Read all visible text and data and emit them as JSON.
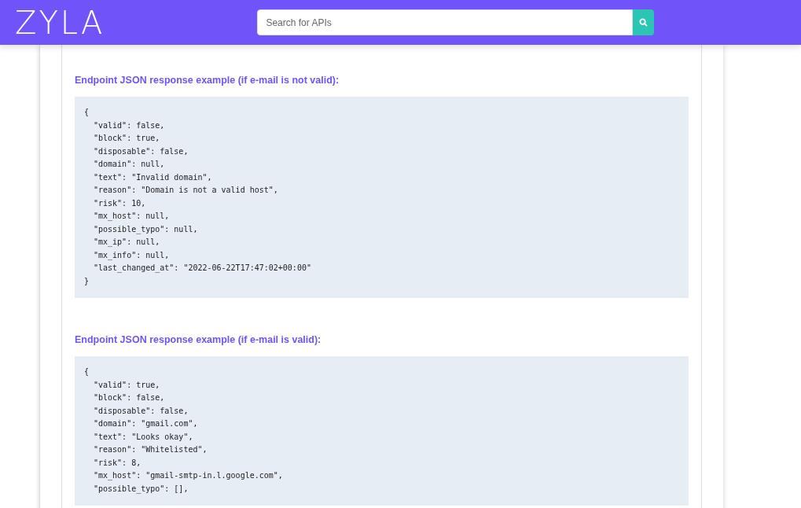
{
  "header": {
    "logo": "ZYLA",
    "search": {
      "placeholder": "Search for APIs"
    }
  },
  "sections": [
    {
      "heading": "Endpoint JSON response example (if e-mail is not valid):",
      "code": {
        "open": "{",
        "children": [
          "\"valid\": false,",
          "\"block\": true,",
          "\"disposable\": false,",
          "\"domain\": null,",
          "\"text\": \"Invalid domain\",",
          "\"reason\": \"Domain is not a valid host\",",
          "\"risk\": 10,",
          "\"mx_host\": null,",
          "\"possible_typo\": null,",
          "\"mx_ip\": null,",
          "\"mx_info\": null,",
          "\"last_changed_at\": \"2022-06-22T17:47:02+00:00\""
        ],
        "close": "}"
      }
    },
    {
      "heading": "Endpoint JSON response example (if e-mail is valid):",
      "code": {
        "open": "{",
        "children": [
          "\"valid\": true,",
          "\"block\": false,",
          "\"disposable\": false,",
          "\"domain\": \"gmail.com\",",
          "\"text\": \"Looks okay\",",
          "\"reason\": \"Whitelisted\",",
          "\"risk\": 8,",
          "\"mx_host\": \"gmail-smtp-in.l.google.com\",",
          "\"possible_typo\": [],"
        ]
      }
    }
  ]
}
